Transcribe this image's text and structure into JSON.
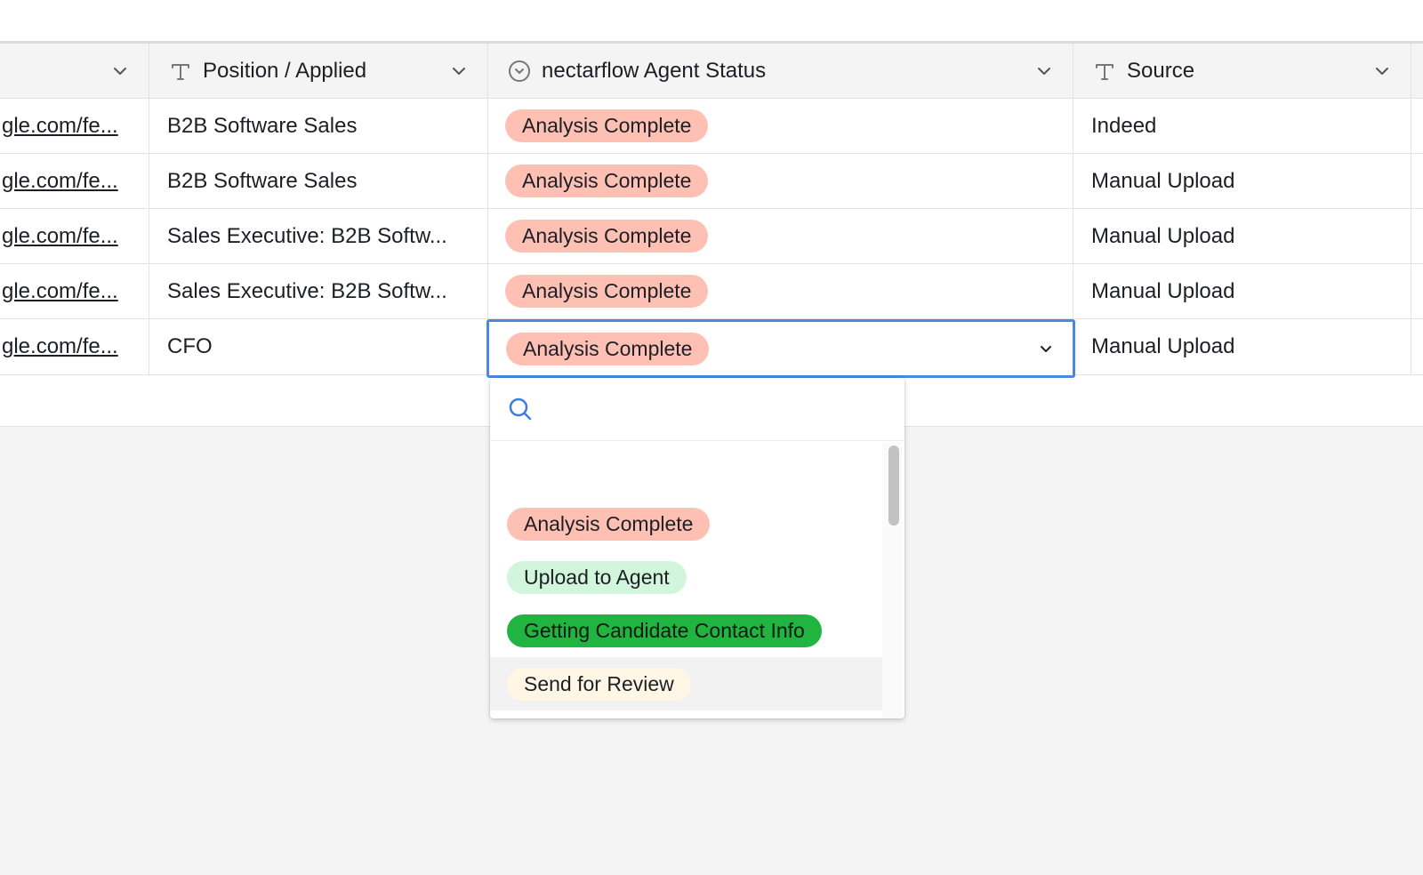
{
  "columns": [
    {
      "label": "",
      "icon": "chevron-down-icon"
    },
    {
      "label": "Position / Applied",
      "icon": "text-field-icon"
    },
    {
      "label": "nectarflow Agent Status",
      "icon": "single-select-icon"
    },
    {
      "label": "Source",
      "icon": "text-field-icon"
    }
  ],
  "rows": [
    {
      "link": "gle.com/fe...",
      "position": "B2B Software Sales",
      "status": "Analysis Complete",
      "source": "Indeed"
    },
    {
      "link": "gle.com/fe...",
      "position": "B2B Software Sales",
      "status": "Analysis Complete",
      "source": "Manual Upload"
    },
    {
      "link": "gle.com/fe...",
      "position": "Sales Executive: B2B Softw...",
      "status": "Analysis Complete",
      "source": "Manual Upload"
    },
    {
      "link": "gle.com/fe...",
      "position": "Sales Executive: B2B Softw...",
      "status": "Analysis Complete",
      "source": "Manual Upload"
    },
    {
      "link": "gle.com/fe...",
      "position": "CFO",
      "status": "Analysis Complete",
      "source": "Manual Upload"
    }
  ],
  "selected_cell": {
    "row": 5,
    "value": "Analysis Complete"
  },
  "dropdown": {
    "search": {
      "value": "",
      "placeholder": ""
    },
    "options": [
      {
        "label": "Analysis Complete",
        "color": "#ffc0b4"
      },
      {
        "label": "Upload to Agent",
        "color": "#d1f6dc"
      },
      {
        "label": "Getting Candidate Contact Info",
        "color": "#21b441"
      },
      {
        "label": "Send for Review",
        "color": "#fff6e6"
      }
    ],
    "hovered_option": "Send for Review"
  },
  "colors": {
    "accent_border": "#4c87e6",
    "status_pill": "#ffc0b4"
  }
}
